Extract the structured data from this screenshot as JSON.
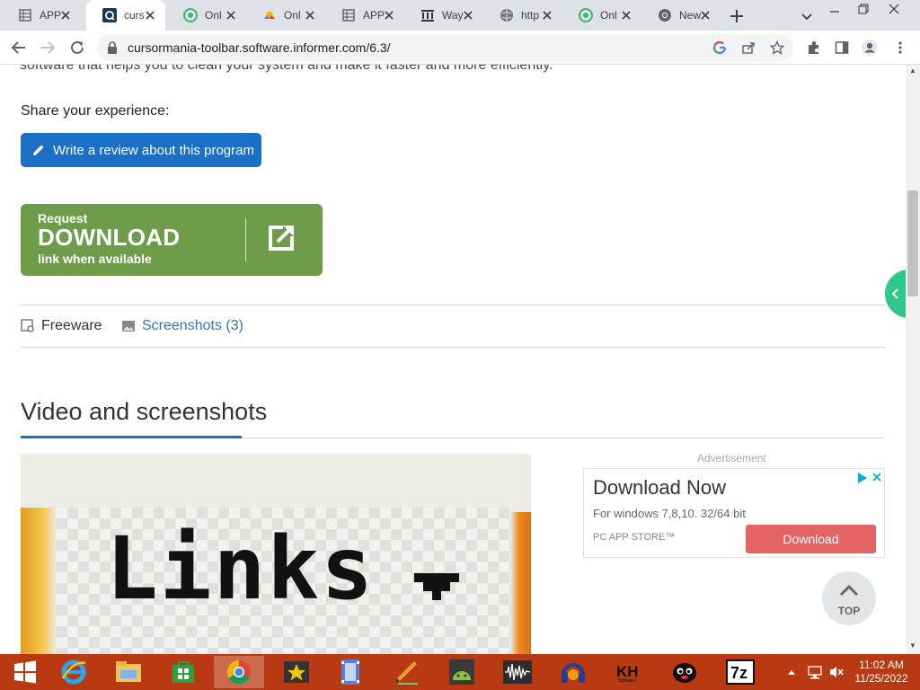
{
  "browser": {
    "tabs": [
      {
        "label": "APP",
        "icon": "sheet-icon",
        "active": false
      },
      {
        "label": "curs",
        "icon": "informer-icon",
        "active": true
      },
      {
        "label": "Onl",
        "icon": "green-p-icon",
        "active": false
      },
      {
        "label": "Onl",
        "icon": "drive-icon",
        "active": false
      },
      {
        "label": "APP",
        "icon": "sheet-icon",
        "active": false
      },
      {
        "label": "Way",
        "icon": "archive-icon",
        "active": false
      },
      {
        "label": "http",
        "icon": "globe-icon",
        "active": false
      },
      {
        "label": "Onl",
        "icon": "green-p-icon",
        "active": false
      },
      {
        "label": "New",
        "icon": "chrome-icon",
        "active": false
      }
    ],
    "url": "cursormania-toolbar.software.informer.com/6.3/"
  },
  "page": {
    "cut_text": "software that helps you to clean your system and make it faster and more efficiently.",
    "share_label": "Share your experience:",
    "review_button": "Write a review about this program",
    "download": {
      "line1": "Request",
      "line2": "DOWNLOAD",
      "line3": "link when available"
    },
    "license": "Freeware",
    "screenshots_link": "Screenshots (3)",
    "section_title": "Video and screenshots",
    "video_text": "Links"
  },
  "ad": {
    "label": "Advertisement",
    "title": "Download Now",
    "subtitle": "For windows 7,8,10. 32/64 bit",
    "store": "PC APP STORE™",
    "button": "Download"
  },
  "top_button": "TOP",
  "taskbar": {
    "apps": [
      "internet-explorer-icon",
      "file-explorer-icon",
      "store-icon",
      "chrome-icon",
      "movie-maker-icon",
      "film-icon",
      "pencil-app-icon",
      "android-icon",
      "audio-wave-icon",
      "headphones-icon",
      "kh-software-icon",
      "penguin-icon",
      "7zip-icon"
    ],
    "time": "11:02 AM",
    "date": "11/25/2022"
  },
  "colors": {
    "accent_blue": "#1a6fc7",
    "download_green": "#6e9d49",
    "ad_button": "#e36462",
    "taskbar": "#b93a12",
    "side_tab": "#2fc78a"
  }
}
